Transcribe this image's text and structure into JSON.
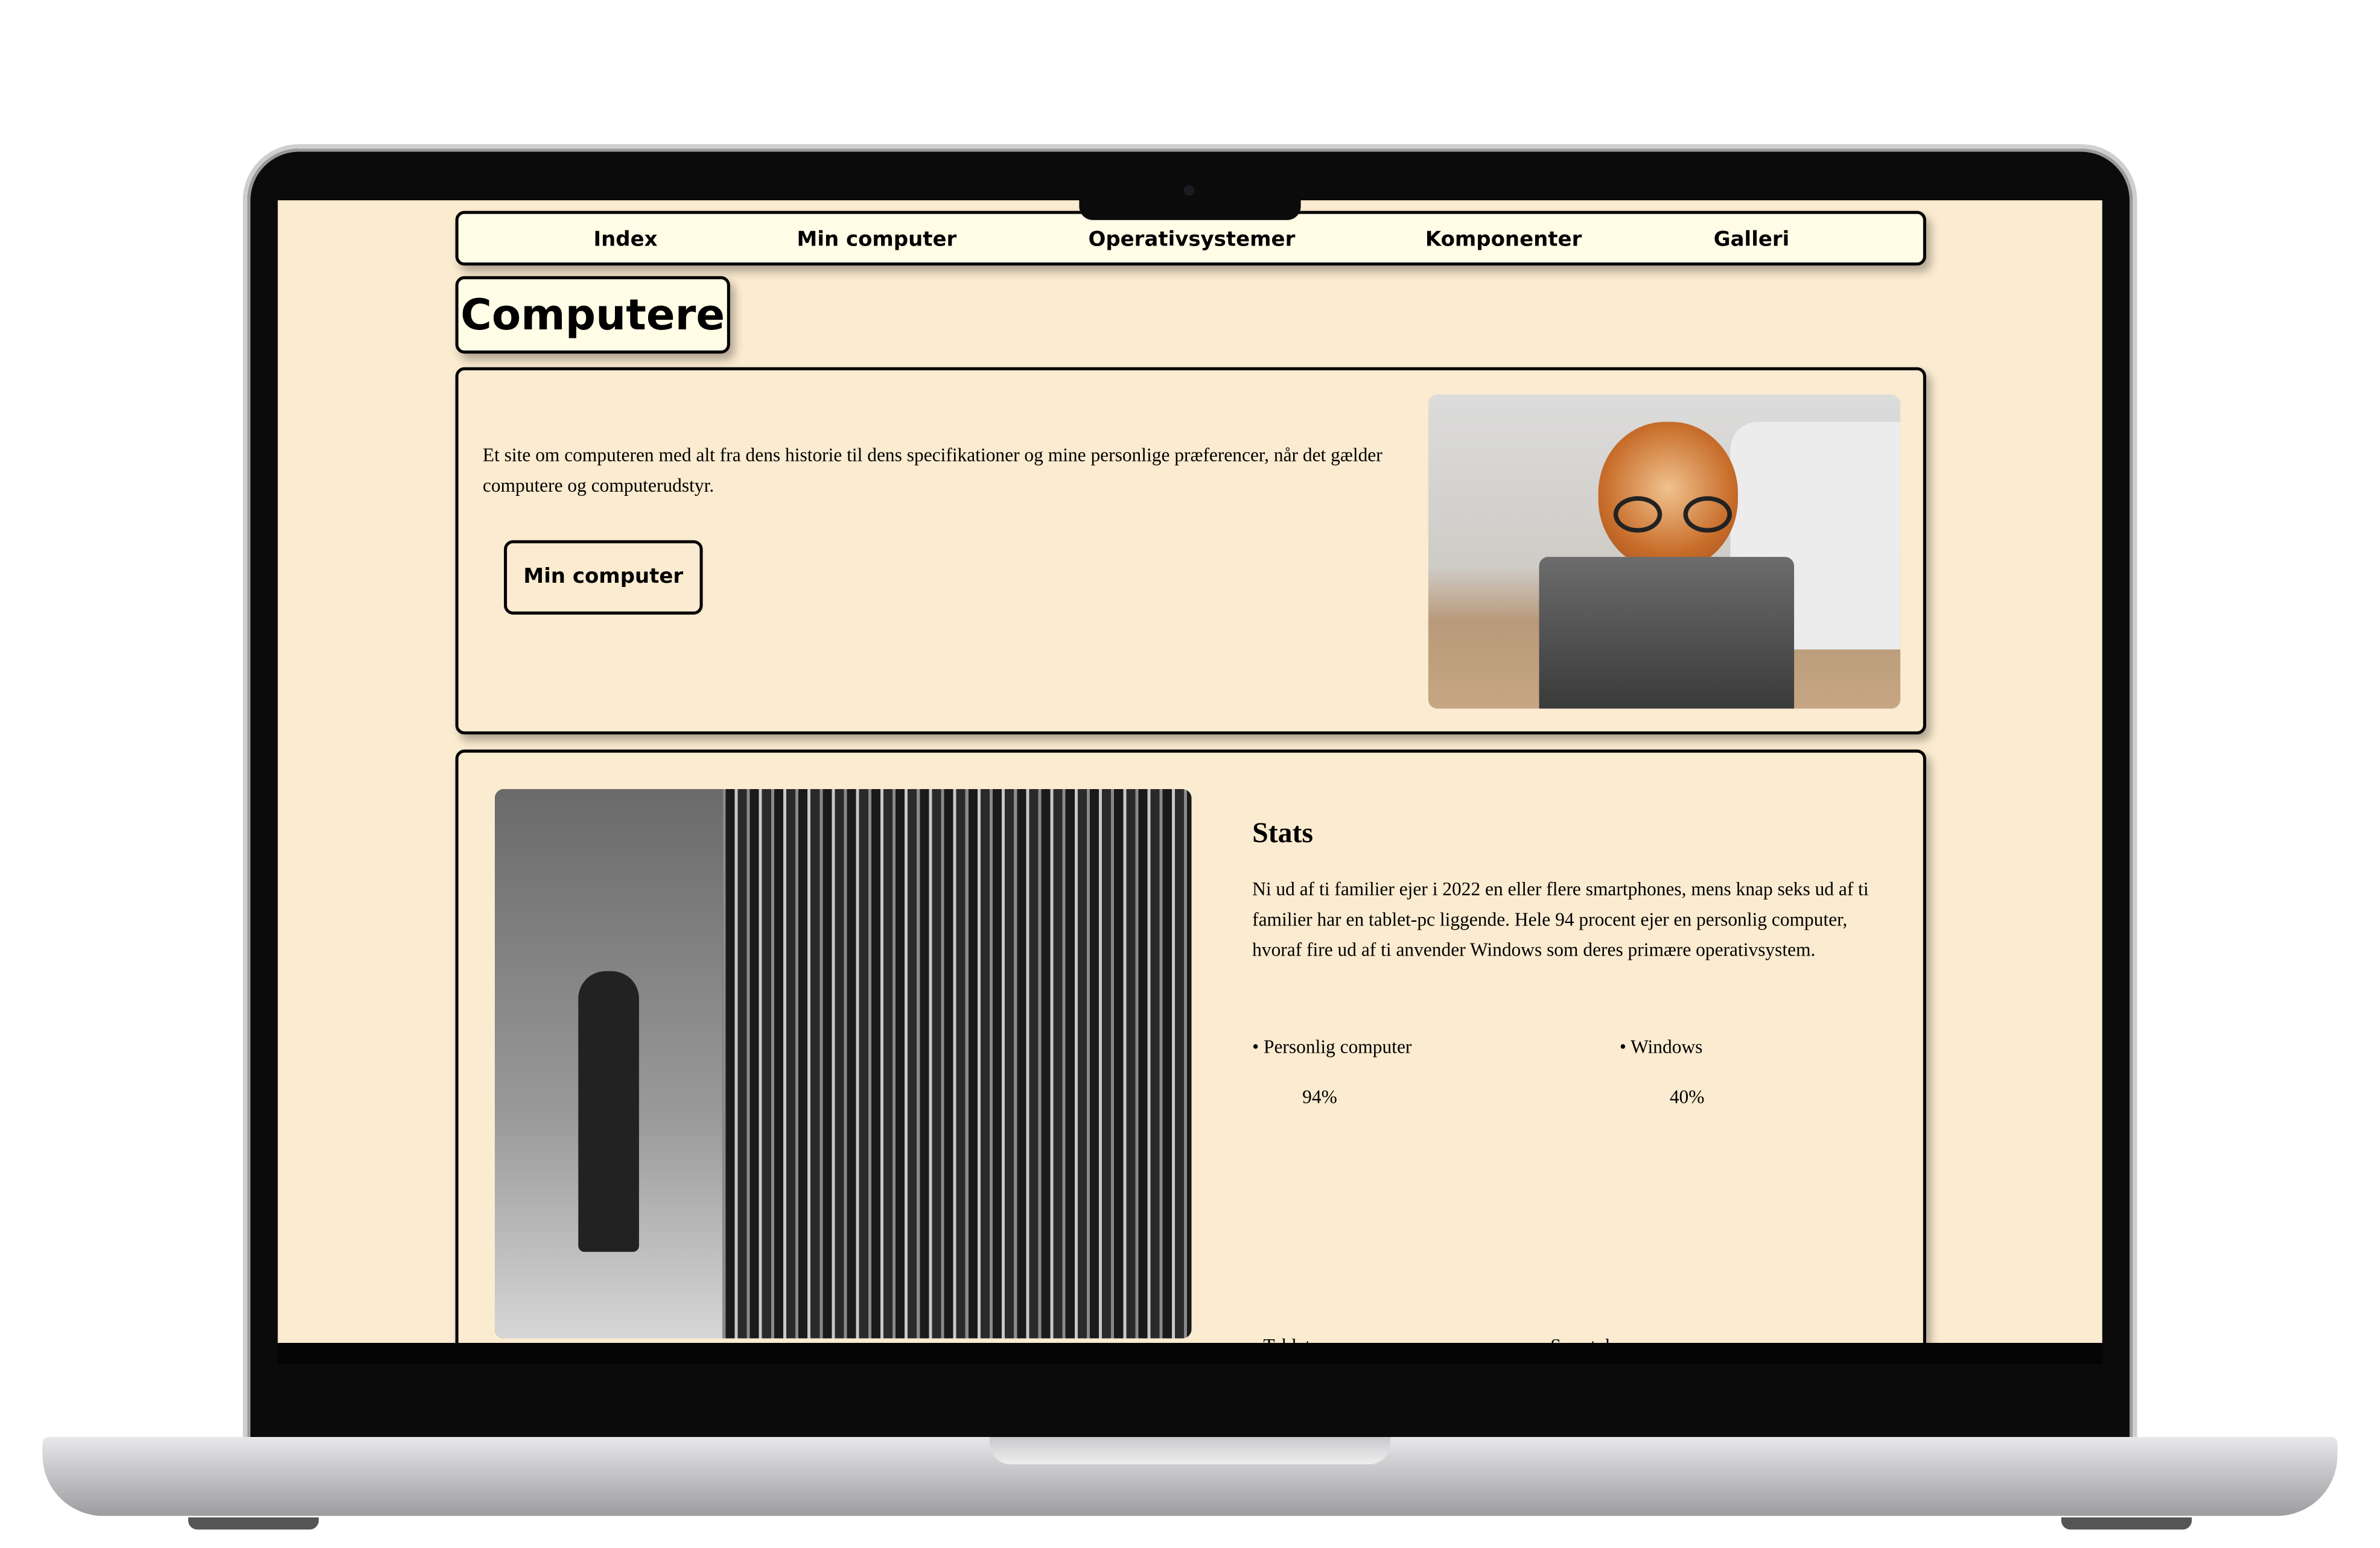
{
  "nav": {
    "items": [
      "Index",
      "Min computer",
      "Operativsystemer",
      "Komponenter",
      "Galleri"
    ]
  },
  "page_title": "Computere",
  "intro": {
    "text": "Et site om computeren med alt fra dens historie til dens specifikationer og mine personlige præferencer, når det gælder computere og computerudstyr.",
    "button_label": "Min computer"
  },
  "stats": {
    "heading": "Stats",
    "paragraph": "Ni ud af ti familier ejer i 2022 en eller flere smartphones, mens knap seks ud af ti familier har en tablet-pc liggende. Hele 94 procent ejer en personlig computer, hvoraf fire ud af ti anvender Windows som deres primære operativsystem.",
    "items": [
      {
        "label": "• Personlig computer",
        "value": "94%"
      },
      {
        "label": "• Windows",
        "value": "40%"
      },
      {
        "label": "• Tablet",
        "value": ""
      },
      {
        "label": "• Smartphone",
        "value": ""
      }
    ]
  },
  "colors": {
    "page_bg": "#fbebd0",
    "box_bg": "#fffde6"
  }
}
